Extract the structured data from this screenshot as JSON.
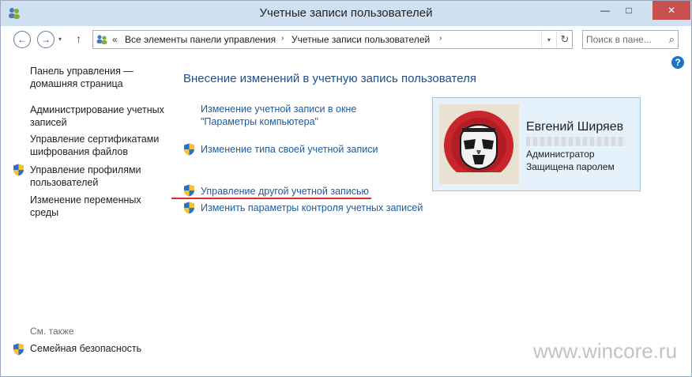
{
  "window": {
    "title": "Учетные записи пользователей",
    "icon": "users-control-panel-icon",
    "controls": {
      "minimize": "—",
      "maximize": "□",
      "close": "✕"
    }
  },
  "navigation": {
    "back_icon": "←",
    "forward_icon": "→",
    "recent_icon": "▾",
    "up_icon": "↑",
    "breadcrumb_prefix": "«",
    "breadcrumbs": [
      "Все элементы панели управления",
      "Учетные записи пользователей"
    ],
    "breadcrumb_separator": "›",
    "address_dropdown_icon": "▾",
    "refresh_icon": "↻"
  },
  "search": {
    "placeholder": "Поиск в пане...",
    "icon": "⌕"
  },
  "help": {
    "label": "?"
  },
  "sidebar": {
    "home_link": "Панель управления — домашняя страница",
    "links": [
      {
        "label": "Администрирование учетных записей",
        "shield": false
      },
      {
        "label": "Управление сертификатами шифрования файлов",
        "shield": false
      },
      {
        "label": "Управление профилями пользователей",
        "shield": true
      },
      {
        "label": "Изменение переменных среды",
        "shield": false
      }
    ],
    "see_also_label": "См. также",
    "see_also_links": [
      {
        "label": "Семейная безопасность",
        "shield": true
      }
    ]
  },
  "main": {
    "heading": "Внесение изменений в учетную запись пользователя",
    "tasks": [
      {
        "label": "Изменение учетной записи в окне \"Параметры компьютера\"",
        "shield": false
      },
      {
        "label": "Изменение типа своей учетной записи",
        "shield": true
      },
      {
        "label": "Управление другой учетной записью",
        "shield": true,
        "annotated": true
      },
      {
        "label": "Изменить параметры контроля учетных записей",
        "shield": true
      }
    ]
  },
  "user_card": {
    "name": "Евгений Ширяев",
    "role": "Администратор",
    "password_status": "Защищена паролем"
  },
  "watermark": "www.wincore.ru",
  "colors": {
    "titlebar": "#cfe0f1",
    "link": "#1c5b9e",
    "heading": "#1e4e8c",
    "card_bg": "#e6f2fb",
    "card_border": "#9cc5e6",
    "annotation": "#e02a2a",
    "close_button": "#c75050"
  }
}
